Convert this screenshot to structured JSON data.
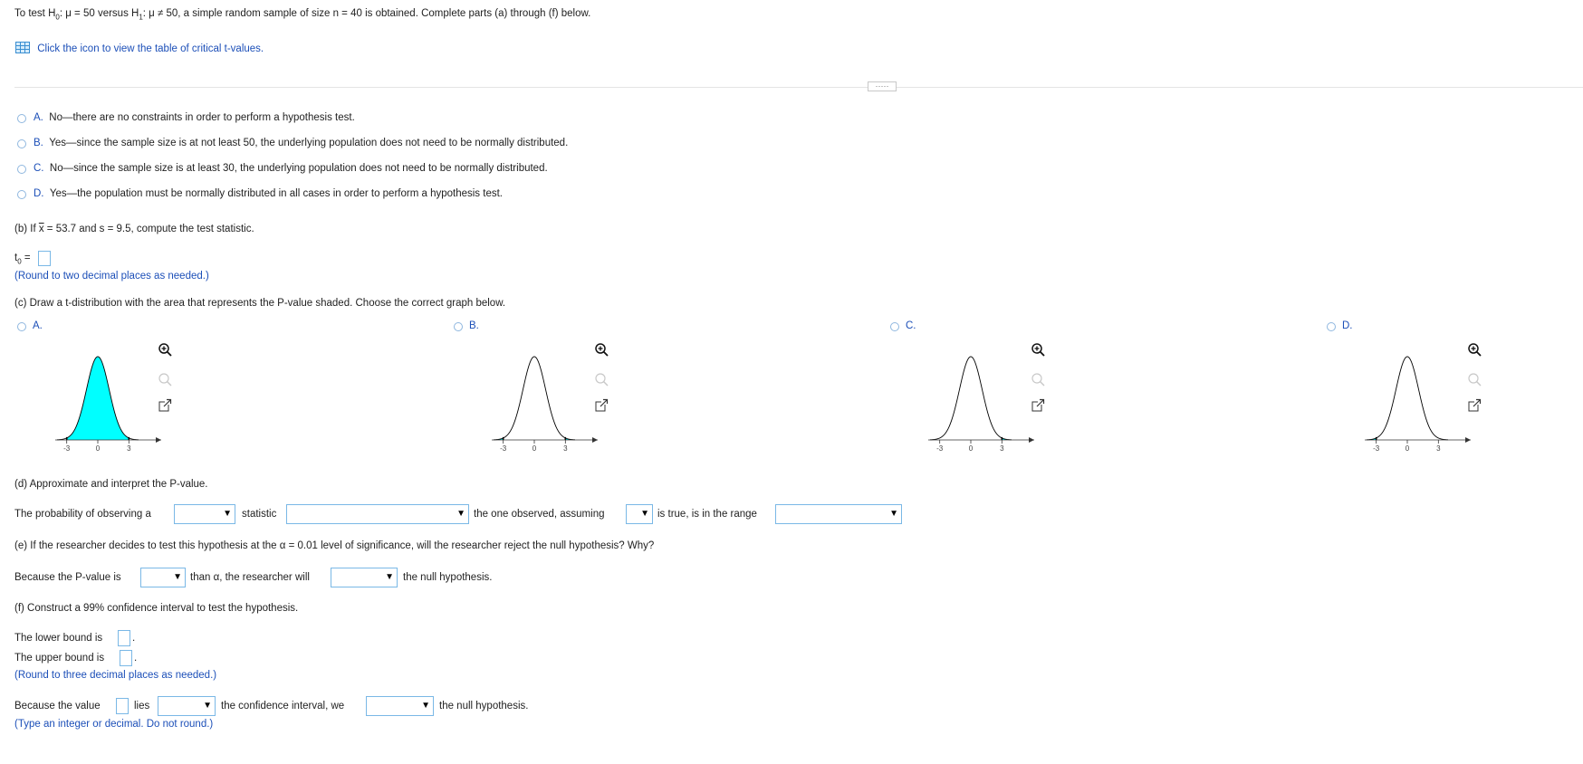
{
  "intro": {
    "prefix": "To test H",
    "h0_sub": "0",
    "h0_rest": ": μ = 50 versus H",
    "h1_sub": "1",
    "suffix": ": μ ≠ 50, a simple random sample of size n = 40 is obtained. Complete parts (a) through (f) below."
  },
  "table_link": "Click the icon to view the table of critical t-values.",
  "divider_handle": "·····",
  "part_a": {
    "options": [
      {
        "letter": "A.",
        "text": "No—there are no constraints in order to perform a hypothesis test."
      },
      {
        "letter": "B.",
        "text": "Yes—since the sample size is at not least 50, the underlying population does not need to be normally distributed."
      },
      {
        "letter": "C.",
        "text": "No—since the sample size is at least 30, the underlying population does not need to be normally distributed."
      },
      {
        "letter": "D.",
        "text": "Yes—the population must be normally distributed in all cases in order to perform a hypothesis test."
      }
    ]
  },
  "part_b": {
    "prompt_start": "(b) If ",
    "xbar": "x",
    "prompt_end": " = 53.7 and s = 9.5, compute the test statistic.",
    "t_label": "t",
    "t_sub": "0",
    "eq": " =",
    "hint": "(Round to two decimal places as needed.)"
  },
  "part_c": {
    "prompt": "(c) Draw a t-distribution with the area that represents the P-value shaded. Choose the correct graph below.",
    "graphs": [
      {
        "letter": "A.",
        "shading": "center",
        "ticks": [
          "-3",
          "0",
          "3"
        ]
      },
      {
        "letter": "B.",
        "shading": "both-tails",
        "ticks": [
          "-3",
          "0",
          "3"
        ]
      },
      {
        "letter": "C.",
        "shading": "right-tail",
        "ticks": [
          "-3",
          "0",
          "3"
        ]
      },
      {
        "letter": "D.",
        "shading": "left-tail",
        "ticks": [
          "-3",
          "0",
          "3"
        ]
      }
    ],
    "shade_color": "#00ffff"
  },
  "part_d": {
    "prompt": "(d) Approximate and interpret the P-value.",
    "s1": "The probability of observing a",
    "s2": "statistic",
    "s3": "the one observed, assuming",
    "s4": "is true, is in the range"
  },
  "part_e": {
    "prompt": "(e) If the researcher decides to test this hypothesis at the α = 0.01 level of significance, will the researcher reject the null hypothesis? Why?",
    "s1": "Because the P-value is",
    "s2": "than α, the researcher will",
    "s3": "the null hypothesis."
  },
  "part_f": {
    "prompt": "(f) Construct a 99% confidence interval to test the hypothesis.",
    "lower": "The lower bound is",
    "upper": "The upper bound is",
    "period": ".",
    "hint": "(Round to three decimal places as needed.)",
    "c1": "Because the value",
    "c2": "lies",
    "c3": "the confidence interval, we",
    "c4": "the null hypothesis.",
    "hint2": "(Type an integer or decimal. Do not round.)"
  },
  "dropdown_arrow": "▼",
  "colors": {
    "link": "#1c4fb8",
    "input_border": "#7ab8e6"
  }
}
